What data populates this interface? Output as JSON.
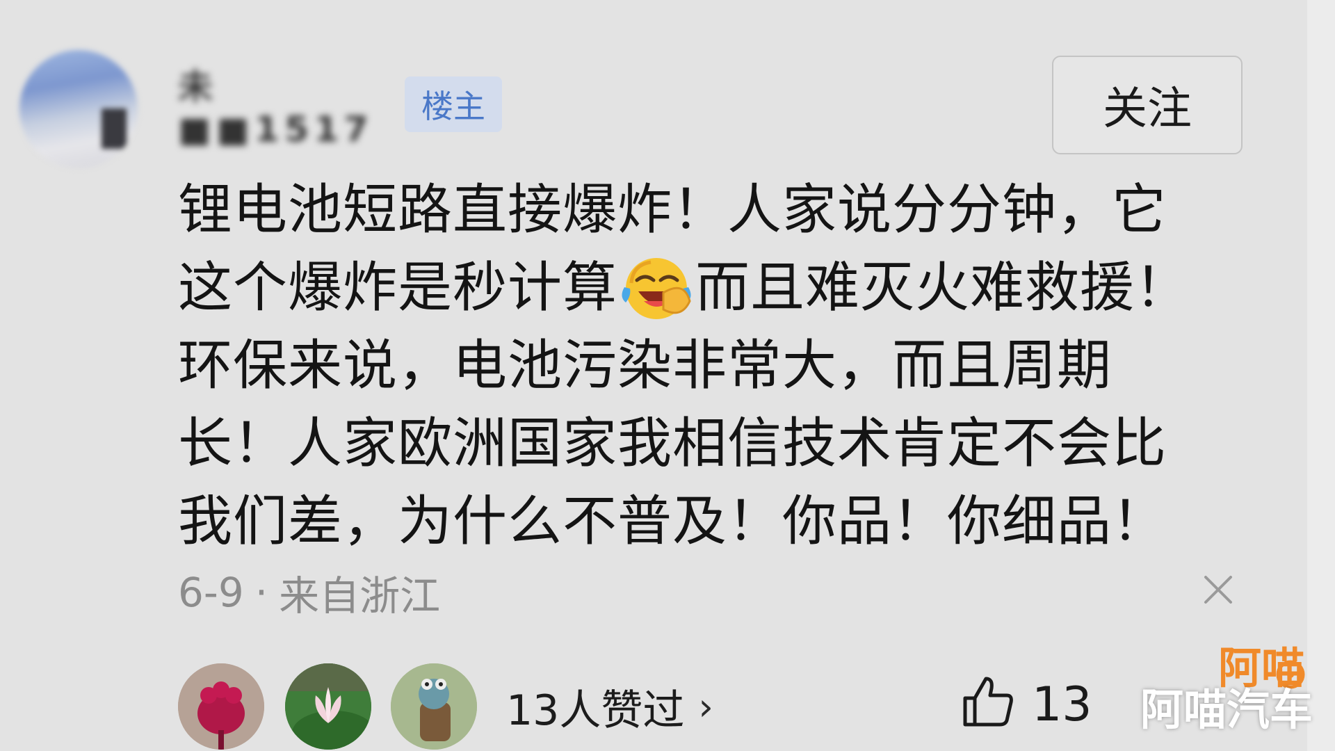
{
  "post": {
    "username": "未■■1517",
    "op_badge": "楼主",
    "follow_label": "关注",
    "comment_lines": [
      "锂电池短路直接爆炸！人家说分分钟，它",
      "这个爆炸是秒计算",
      "而且难灭火难救援！",
      "环保来说，电池污染非常大，而且周期",
      "长！人家欧洲国家我相信技术肯定不会比",
      "我们差，为什么不普及！你品！你细品！"
    ],
    "emoji": "laughing-crying-emoji",
    "date": "6-9",
    "dot": "·",
    "location": "来自浙江"
  },
  "likes": {
    "likers_label": "13人赞过",
    "chevron": "›",
    "count": "13"
  },
  "watermark": {
    "text": "阿喵汽车",
    "logo_text": "阿喵"
  },
  "colors": {
    "background": "#e3e3e3",
    "badge_text": "#4a78c8",
    "badge_bg": "#d3dced",
    "meta_text": "#8c8c8c",
    "watermark_orange": "#f08a2a"
  }
}
